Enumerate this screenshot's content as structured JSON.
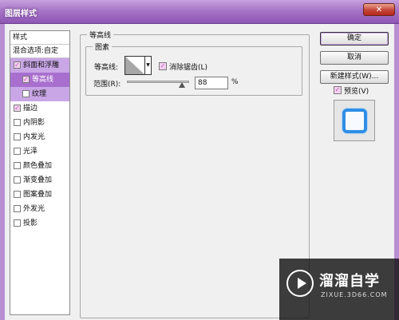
{
  "window": {
    "title": "图层样式",
    "close_glyph": "✕"
  },
  "styles_list": {
    "header": "样式",
    "blend_options": "混合选项:自定",
    "items": [
      {
        "label": "斜面和浮雕",
        "checked": true
      },
      {
        "label": "等高线",
        "checked": true
      },
      {
        "label": "纹理",
        "checked": false
      },
      {
        "label": "描边",
        "checked": true
      },
      {
        "label": "内阴影",
        "checked": false
      },
      {
        "label": "内发光",
        "checked": false
      },
      {
        "label": "光泽",
        "checked": false
      },
      {
        "label": "颜色叠加",
        "checked": false
      },
      {
        "label": "渐变叠加",
        "checked": false
      },
      {
        "label": "图案叠加",
        "checked": false
      },
      {
        "label": "外发光",
        "checked": false
      },
      {
        "label": "投影",
        "checked": false
      }
    ]
  },
  "contour_panel": {
    "group_title": "等高线",
    "elements_title": "图素",
    "contour_label": "等高线:",
    "antialias_label": "消除锯齿(L)",
    "antialias_checked": true,
    "range_label": "范围(R):",
    "range_value": "88",
    "range_unit": "%"
  },
  "actions": {
    "ok": "确定",
    "cancel": "取消",
    "new_style": "新建样式(W)...",
    "preview_label": "预览(V)",
    "preview_checked": true
  },
  "watermark": {
    "title": "溜溜自学",
    "url": "ZIXUE.3D66.COM"
  },
  "colors": {
    "title_bar": "#a675c6",
    "selection": "#a86fcf",
    "highlight": "#c9a6e6",
    "preview_icon": "#2f8ee6"
  }
}
